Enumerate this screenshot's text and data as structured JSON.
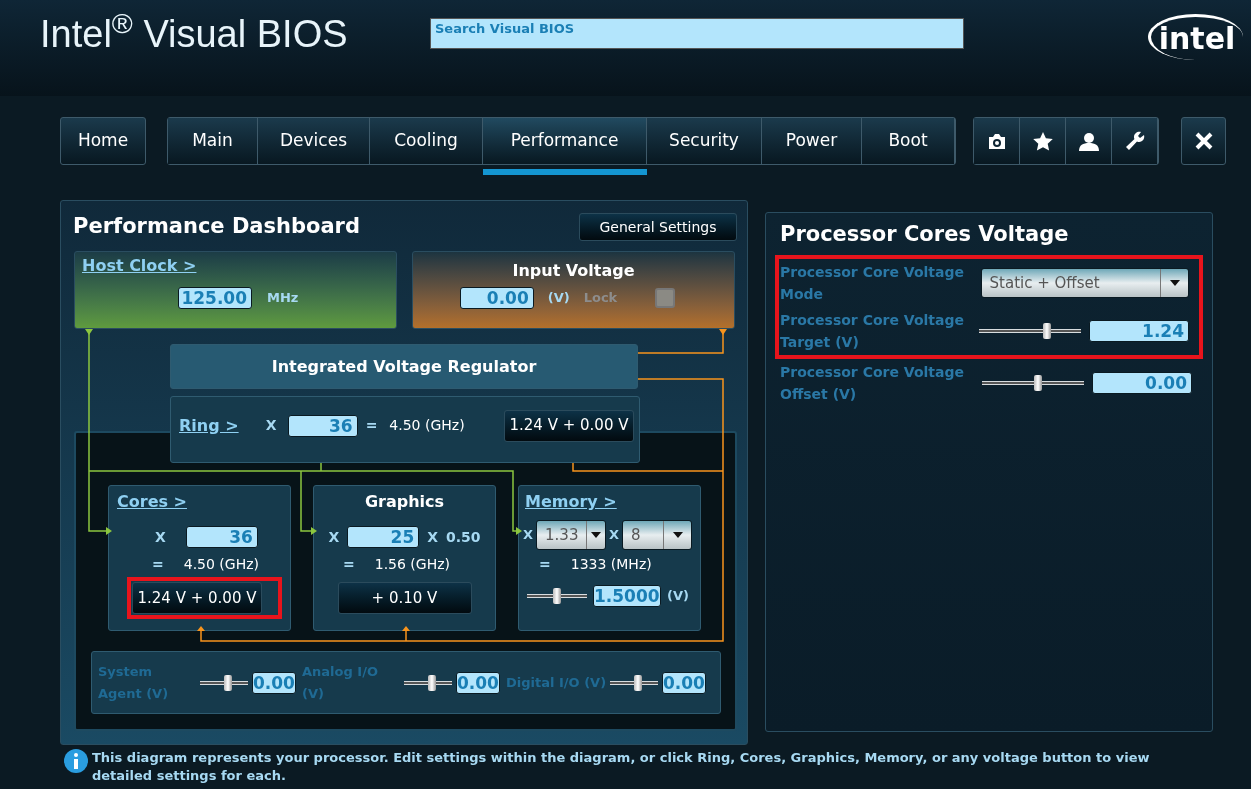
{
  "header": {
    "title": "Intel$^{®}$ Visual BIOS",
    "search": {
      "placeholder": "Search Visual BIOS"
    },
    "logo": "intel"
  },
  "nav": {
    "home": {
      "label": "Home",
      "selected": false
    },
    "tabs": [
      {
        "label": "Main",
        "selected": false
      },
      {
        "label": "Devices",
        "selected": false
      },
      {
        "label": "Cooling",
        "selected": false
      },
      {
        "label": "Performance",
        "selected": true
      },
      {
        "label": "Security",
        "selected": false
      },
      {
        "label": "Power",
        "selected": false
      },
      {
        "label": "Boot",
        "selected": false
      }
    ],
    "tools": [
      {
        "kind": "camera"
      },
      {
        "kind": "star"
      },
      {
        "kind": "user"
      },
      {
        "kind": "wrench"
      }
    ]
  },
  "dashboard": {
    "title": "Performance Dashboard",
    "general_settings": "General Settings",
    "host_clock": {
      "label": "Host Clock >",
      "value": "125.00",
      "unit": "MHz"
    },
    "input_voltage": {
      "title": "Input Voltage",
      "value": "0.00",
      "unit": "(V)",
      "lock_label": "Lock",
      "locked": false
    },
    "ivr": "Integrated Voltage Regulator",
    "ring": {
      "label": "Ring >",
      "x": "X",
      "multiplier": "36",
      "equals": "=",
      "frequency": "4.50 (GHz)",
      "voltage": "1.24 V + 0.00 V",
      "highlighted": false
    },
    "cores": {
      "label": "Cores >",
      "x": "X",
      "multiplier": "36",
      "equals": "=",
      "frequency": "4.50 (GHz)",
      "voltage": "1.24 V + 0.00 V",
      "highlighted": true
    },
    "graphics": {
      "title": "Graphics",
      "x": "X",
      "multiplier": "25",
      "x2": "X",
      "ratio": "0.50",
      "equals": "=",
      "frequency": "1.56 (GHz)",
      "voltage": "+ 0.10 V",
      "highlighted": false
    },
    "memory": {
      "label": "Memory >",
      "x": "X",
      "ratio": "1.33",
      "x2": "X",
      "multiplier": "8",
      "equals": "=",
      "frequency": "1333 (MHz)",
      "voltage": "1.5000",
      "unit": "(V)",
      "level": 0.5
    },
    "rails": [
      {
        "label": "System Agent (V)",
        "value": "0.00",
        "level": 0.6
      },
      {
        "label": "Analog I/O (V)",
        "value": "0.00",
        "level": 0.6
      },
      {
        "label": "Digital I/O (V)",
        "value": "0.00",
        "level": 0.6
      }
    ]
  },
  "voltage_panel": {
    "title": "Processor Cores Voltage",
    "fields": [
      {
        "kind": "dropdown",
        "label": "Processor Core Voltage Mode",
        "value": "Static + Offset",
        "highlighted": true
      },
      {
        "kind": "slider",
        "label": "Processor Core Voltage Target (V)",
        "value": "1.24",
        "level": 0.68,
        "highlighted": true
      },
      {
        "kind": "slider",
        "label": "Processor Core Voltage Offset (V)",
        "value": "0.00",
        "level": 0.55,
        "highlighted": false
      }
    ]
  },
  "footer": "This diagram represents your processor. Edit settings within the diagram, or click Ring, Cores, Graphics, Memory, or any voltage button to view detailed settings for each."
}
